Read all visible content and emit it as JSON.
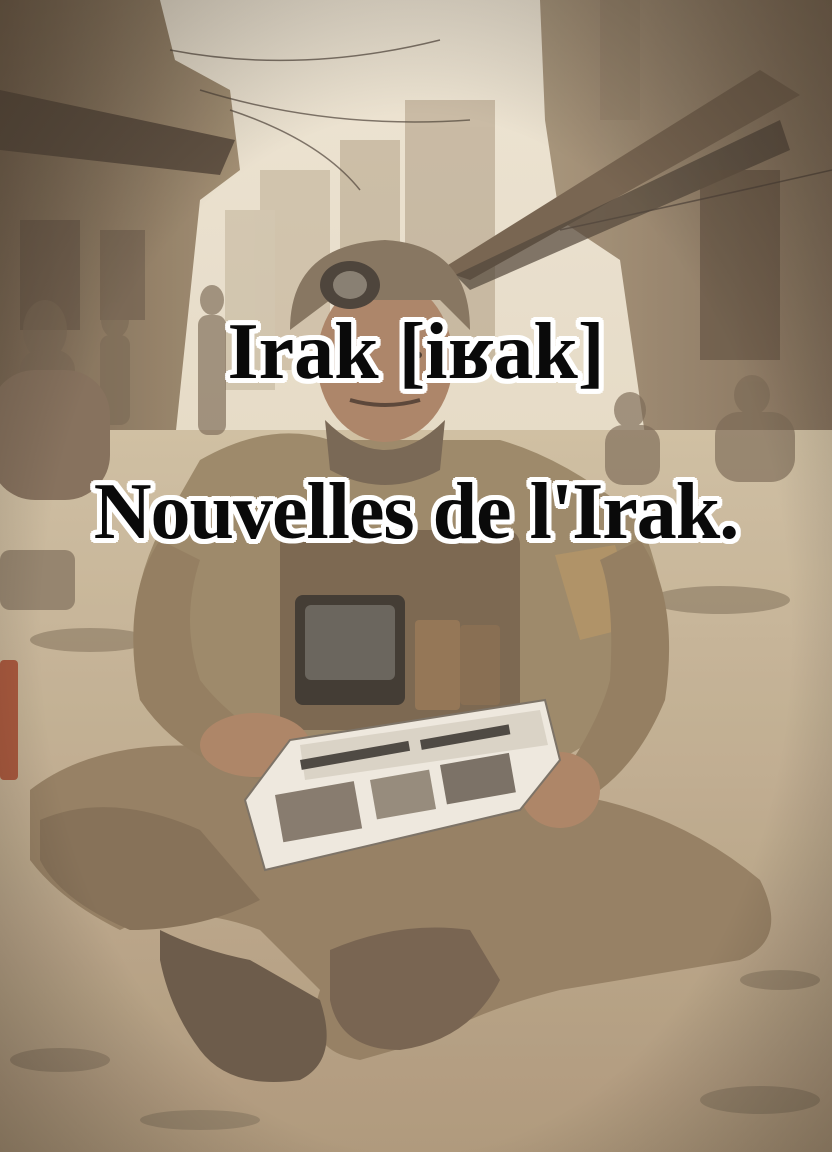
{
  "caption": {
    "line1": "Irak [iʁak]",
    "line2": "Nouvelles de l'Irak."
  },
  "scene": {
    "subject": "soldier-reading-newspaper",
    "palette": {
      "sky": "#e8dfcc",
      "dust": "#c9b796",
      "uniform": "#8f7a5c",
      "shadow": "#4a3e30",
      "paper": "#efebe2"
    }
  }
}
